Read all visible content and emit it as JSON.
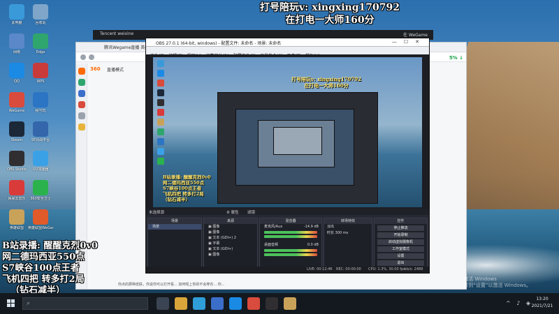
{
  "overlay_top": {
    "line1": "打号陪玩v: xingxing170792",
    "line2": "在打电一大师160分"
  },
  "overlay_left": {
    "lines": [
      "B站录播: 醒醒克烈0v0",
      "网二德玛西亚550点",
      "S7峡谷100点王者",
      "飞机四把 转多打2局",
      "（钻石减半）"
    ]
  },
  "desktop_icons": [
    {
      "label": "此电脑",
      "color": "#3a9ad9"
    },
    {
      "label": "网络",
      "color": "#5a88c8"
    },
    {
      "label": "QQ",
      "color": "#1a8ae5"
    },
    {
      "label": "WeGame",
      "color": "#d94b3c"
    },
    {
      "label": "Steam",
      "color": "#1b2838"
    },
    {
      "label": "OBS Studio",
      "color": "#302e31"
    },
    {
      "label": "网易云音乐",
      "color": "#d93a3a"
    },
    {
      "label": "英雄联盟",
      "color": "#c9a25a"
    },
    {
      "label": "回收站",
      "color": "#7fa6c9"
    },
    {
      "label": "Edge",
      "color": "#2fa66d"
    },
    {
      "label": "WPS",
      "color": "#c93b3b"
    },
    {
      "label": "租号玩",
      "color": "#2c74c4"
    },
    {
      "label": "5E对战平台",
      "color": "#3366aa"
    },
    {
      "label": "UU加速器",
      "color": "#3ba1e6"
    },
    {
      "label": "360安全卫士",
      "color": "#2bb24c"
    },
    {
      "label": "英雄联盟WeGame",
      "color": "#e05a2a"
    }
  ],
  "tencent_bar": {
    "left": "Tencent weixine",
    "right": "在 WeGame"
  },
  "browser": {
    "tab": "腾讯Wegame直播 英雄联盟直播",
    "logo": "360",
    "logo_sub": "直播模式",
    "right_label": "5% ↓",
    "status": "你点的那种皮肤，你说你可以打开看... 如何呢上你的不会穿衣... 你...",
    "watermark": [
      "激活 Windows",
      "转到“设置”以激活 Windows。"
    ]
  },
  "obs": {
    "title": "OBS 27.0.1 (64-bit, windows) - 配置文件: 未命名 - 场景: 未命名",
    "menu": [
      "文件(F)",
      "编辑(E)",
      "视图(V)",
      "停靠部件(D)",
      "配置文件(P)",
      "场景集合(S)",
      "工具(T)",
      "帮助(H)"
    ],
    "preview_title": [
      "打号陪玩v: xingxing170792",
      "在打电一大师160分"
    ],
    "preview_left": [
      "B站录播: 醒醒克烈0v0",
      "网二德玛西亚550点",
      "S7峡谷100点王者",
      "飞机四把 转多打2局",
      "（钻石减半）"
    ],
    "dock_bar": {
      "left": "未选择源",
      "mid1": "⚙ 属性",
      "mid2": "滤镜"
    },
    "scenes": {
      "header": "场景",
      "items": [
        "场景"
      ]
    },
    "sources": {
      "header": "来源",
      "items": [
        "图像",
        "图像",
        "文本 (GDI+) 2",
        "字幕",
        "文本 (GDI+)",
        "图像"
      ]
    },
    "mixer": {
      "header": "混音器",
      "channels": [
        {
          "name": "麦克风/Aux",
          "db": "-14.9 dB"
        },
        {
          "name": "桌面音频",
          "db": "0.0 dB"
        }
      ]
    },
    "transitions": {
      "header": "转场特效",
      "type": "淡出",
      "duration_label": "时长",
      "duration": "300 ms"
    },
    "controls": {
      "header": "控件",
      "buttons": [
        "停止推流",
        "开始录制",
        "启动虚拟摄像机",
        "工作室模式",
        "设置",
        "退出"
      ]
    },
    "status": {
      "live": "LIVE: 00:12:46",
      "rec": "REC: 00:00:00",
      "cpu": "CPU: 1.3%, 30.00 fps",
      "kbps": "kb/s: 2489"
    }
  },
  "taskbar": {
    "search_icon": "search-icon",
    "apps": [
      {
        "name": "task-view",
        "color": "#3b4452"
      },
      {
        "name": "file-explorer",
        "color": "#d9a53a"
      },
      {
        "name": "edge",
        "color": "#2f9ed8"
      },
      {
        "name": "store",
        "color": "#3b6ec9"
      },
      {
        "name": "qq",
        "color": "#1a8ae5"
      },
      {
        "name": "wegame",
        "color": "#d94b3c"
      },
      {
        "name": "obs",
        "color": "#302e31"
      },
      {
        "name": "lol",
        "color": "#c9a25a"
      }
    ],
    "time": "13:20",
    "date": "2021/7/21"
  }
}
